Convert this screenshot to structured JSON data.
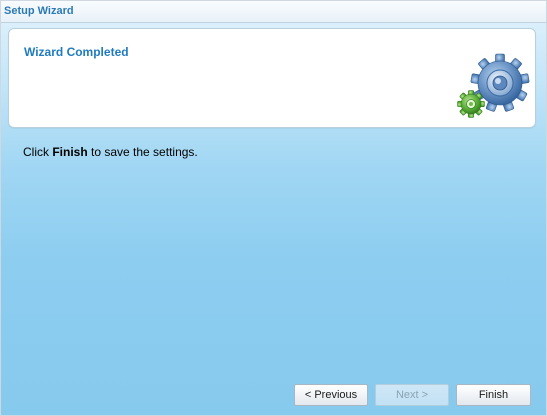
{
  "window": {
    "title": "Setup Wizard"
  },
  "header": {
    "title": "Wizard Completed",
    "icon": "gears-icon"
  },
  "message": {
    "prefix": "Click ",
    "bold": "Finish",
    "suffix": " to save the settings."
  },
  "buttons": {
    "previous": "< Previous",
    "next": "Next >",
    "finish": "Finish",
    "next_disabled": true
  },
  "colors": {
    "title": "#2b7ab5",
    "header_title": "#1f7bbf",
    "background_bottom": "#86caee"
  }
}
